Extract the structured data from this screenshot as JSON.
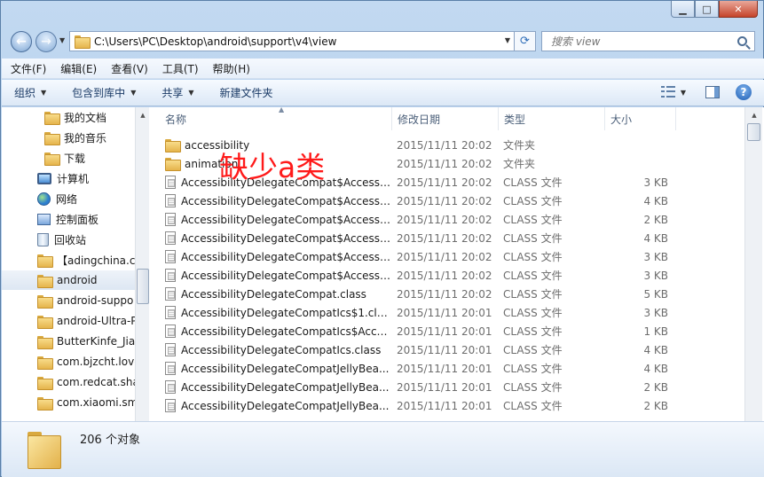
{
  "window": {
    "caption_buttons": {
      "minimize": "▁",
      "maximize": "□",
      "close": "✕"
    }
  },
  "address": {
    "path": "C:\\Users\\PC\\Desktop\\android\\support\\v4\\view",
    "search_placeholder": "搜索 view"
  },
  "menu": [
    {
      "label": "文件(F)"
    },
    {
      "label": "编辑(E)"
    },
    {
      "label": "查看(V)"
    },
    {
      "label": "工具(T)"
    },
    {
      "label": "帮助(H)"
    }
  ],
  "toolbar": {
    "organize": "组织",
    "include_in_library": "包含到库中",
    "share": "共享",
    "new_folder": "新建文件夹"
  },
  "nav": [
    {
      "label": "我的文档",
      "icon": "folder-icon"
    },
    {
      "label": "我的音乐",
      "icon": "folder-icon"
    },
    {
      "label": "下载",
      "icon": "folder-icon"
    },
    {
      "label": "计算机",
      "icon": "computer-icon"
    },
    {
      "label": "网络",
      "icon": "network-icon"
    },
    {
      "label": "控制面板",
      "icon": "control-panel-icon"
    },
    {
      "label": "回收站",
      "icon": "recycle-bin-icon"
    },
    {
      "label": "【adingchina.cc",
      "icon": "folder-icon"
    },
    {
      "label": "android",
      "icon": "folder-icon",
      "selected": true
    },
    {
      "label": "android-suppo",
      "icon": "folder-icon"
    },
    {
      "label": "android-Ultra-P",
      "icon": "folder-icon"
    },
    {
      "label": "ButterKinfe_Jia",
      "icon": "folder-icon"
    },
    {
      "label": "com.bjzcht.love",
      "icon": "folder-icon"
    },
    {
      "label": "com.redcat.sha",
      "icon": "folder-icon"
    },
    {
      "label": "com.xiaomi.sma",
      "icon": "folder-icon"
    }
  ],
  "columns": {
    "name": "名称",
    "date": "修改日期",
    "type": "类型",
    "size": "大小"
  },
  "files": [
    {
      "name": "accessibility",
      "date": "2015/11/11 20:02",
      "type": "文件夹",
      "size": "",
      "kind": "folder"
    },
    {
      "name": "animation",
      "date": "2015/11/11 20:02",
      "type": "文件夹",
      "size": "",
      "kind": "folder"
    },
    {
      "name": "AccessibilityDelegateCompat$Accessi...",
      "date": "2015/11/11 20:02",
      "type": "CLASS 文件",
      "size": "3 KB",
      "kind": "class"
    },
    {
      "name": "AccessibilityDelegateCompat$Accessi...",
      "date": "2015/11/11 20:02",
      "type": "CLASS 文件",
      "size": "4 KB",
      "kind": "class"
    },
    {
      "name": "AccessibilityDelegateCompat$Accessi...",
      "date": "2015/11/11 20:02",
      "type": "CLASS 文件",
      "size": "2 KB",
      "kind": "class"
    },
    {
      "name": "AccessibilityDelegateCompat$Accessi...",
      "date": "2015/11/11 20:02",
      "type": "CLASS 文件",
      "size": "4 KB",
      "kind": "class"
    },
    {
      "name": "AccessibilityDelegateCompat$Accessi...",
      "date": "2015/11/11 20:02",
      "type": "CLASS 文件",
      "size": "3 KB",
      "kind": "class"
    },
    {
      "name": "AccessibilityDelegateCompat$Accessi...",
      "date": "2015/11/11 20:02",
      "type": "CLASS 文件",
      "size": "3 KB",
      "kind": "class"
    },
    {
      "name": "AccessibilityDelegateCompat.class",
      "date": "2015/11/11 20:02",
      "type": "CLASS 文件",
      "size": "5 KB",
      "kind": "class"
    },
    {
      "name": "AccessibilityDelegateCompatIcs$1.cla...",
      "date": "2015/11/11 20:01",
      "type": "CLASS 文件",
      "size": "3 KB",
      "kind": "class"
    },
    {
      "name": "AccessibilityDelegateCompatIcs$Acce...",
      "date": "2015/11/11 20:01",
      "type": "CLASS 文件",
      "size": "1 KB",
      "kind": "class"
    },
    {
      "name": "AccessibilityDelegateCompatIcs.class",
      "date": "2015/11/11 20:01",
      "type": "CLASS 文件",
      "size": "4 KB",
      "kind": "class"
    },
    {
      "name": "AccessibilityDelegateCompatJellyBea...",
      "date": "2015/11/11 20:01",
      "type": "CLASS 文件",
      "size": "4 KB",
      "kind": "class"
    },
    {
      "name": "AccessibilityDelegateCompatJellyBea...",
      "date": "2015/11/11 20:01",
      "type": "CLASS 文件",
      "size": "2 KB",
      "kind": "class"
    },
    {
      "name": "AccessibilityDelegateCompatJellyBea...",
      "date": "2015/11/11 20:01",
      "type": "CLASS 文件",
      "size": "2 KB",
      "kind": "class"
    }
  ],
  "annotation": "缺少a类",
  "status": {
    "count": "206 个对象"
  }
}
